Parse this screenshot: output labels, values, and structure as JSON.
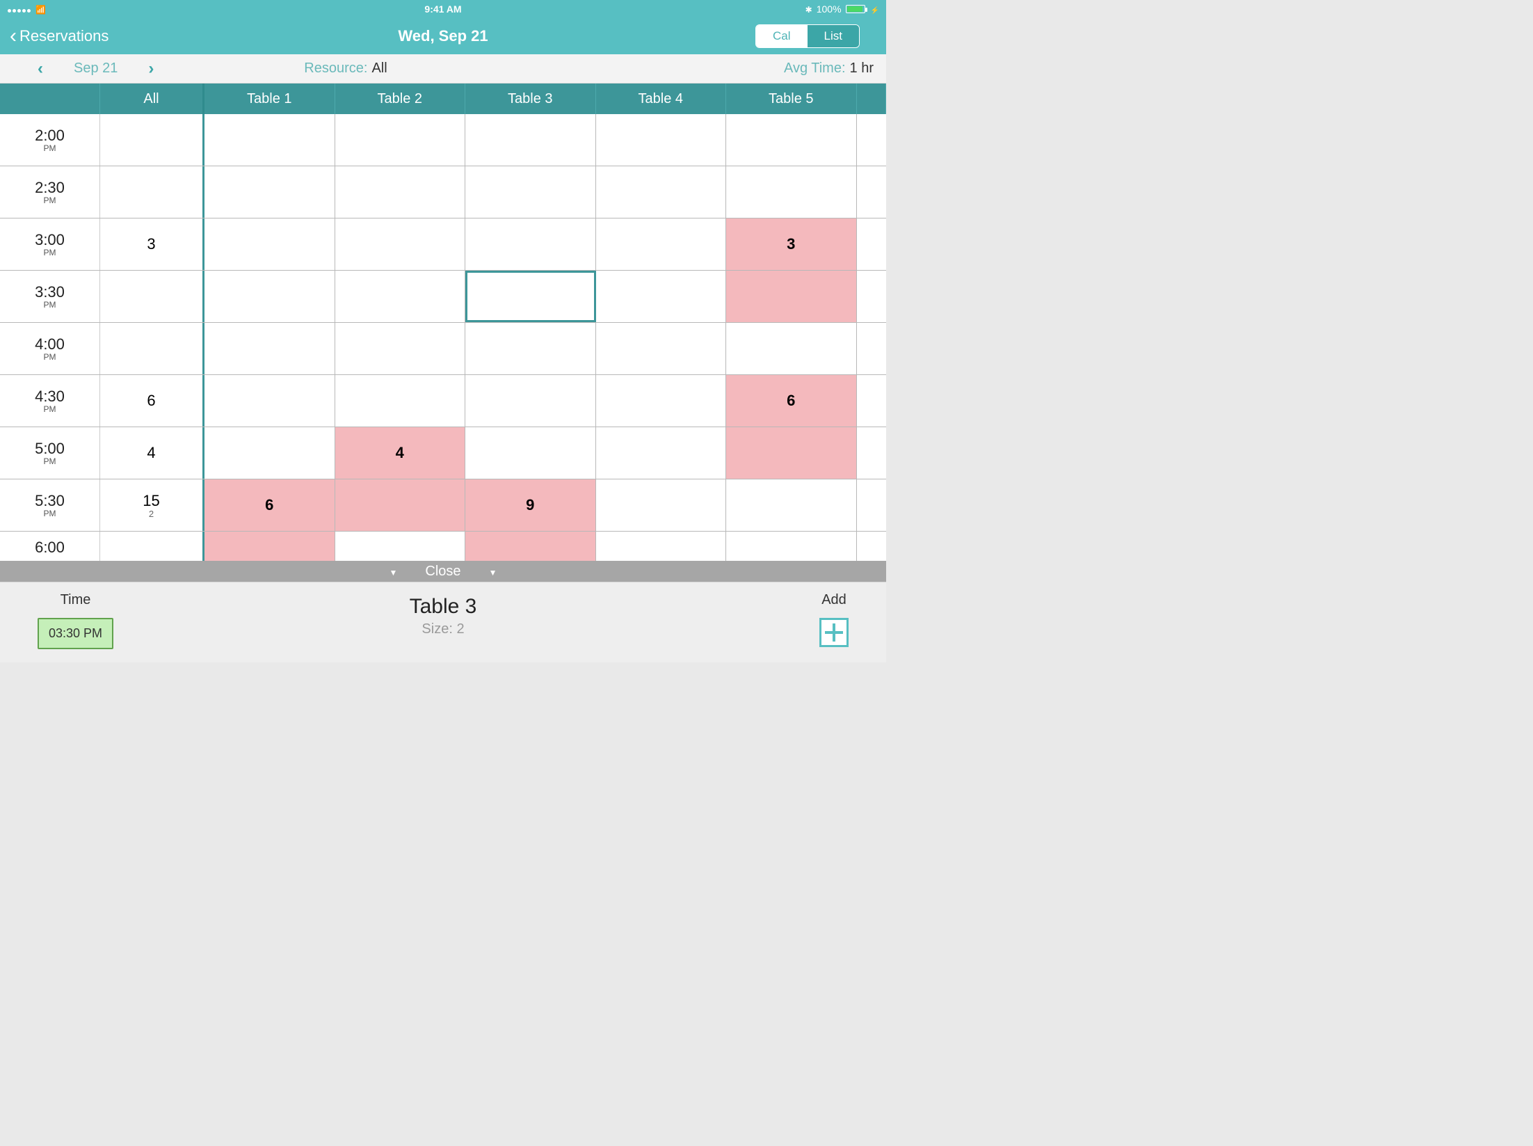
{
  "status_bar": {
    "time": "9:41 AM",
    "battery_pct": "100%"
  },
  "nav": {
    "back_label": "Reservations",
    "title": "Wed, Sep 21",
    "segment_cal": "Cal",
    "segment_list": "List"
  },
  "filter": {
    "date_label": "Sep 21",
    "resource_label": "Resource:",
    "resource_value": "All",
    "avg_label": "Avg Time:",
    "avg_value": "1 hr"
  },
  "columns": {
    "all": "All",
    "resources": [
      "Table 1",
      "Table 2",
      "Table 3",
      "Table 4",
      "Table 5"
    ]
  },
  "rows": [
    {
      "time": "2:00",
      "ampm": "PM",
      "all": "",
      "all_sub": "",
      "cells": [
        {
          "v": "",
          "b": false
        },
        {
          "v": "",
          "b": false
        },
        {
          "v": "",
          "b": false,
          "sel": false
        },
        {
          "v": "",
          "b": false
        },
        {
          "v": "",
          "b": false
        }
      ]
    },
    {
      "time": "2:30",
      "ampm": "PM",
      "all": "",
      "all_sub": "",
      "cells": [
        {
          "v": "",
          "b": false
        },
        {
          "v": "",
          "b": false
        },
        {
          "v": "",
          "b": false
        },
        {
          "v": "",
          "b": false
        },
        {
          "v": "",
          "b": false
        }
      ]
    },
    {
      "time": "3:00",
      "ampm": "PM",
      "all": "3",
      "all_sub": "",
      "cells": [
        {
          "v": "",
          "b": false
        },
        {
          "v": "",
          "b": false
        },
        {
          "v": "",
          "b": false
        },
        {
          "v": "",
          "b": false
        },
        {
          "v": "3",
          "b": true
        }
      ]
    },
    {
      "time": "3:30",
      "ampm": "PM",
      "all": "",
      "all_sub": "",
      "cells": [
        {
          "v": "",
          "b": false
        },
        {
          "v": "",
          "b": false
        },
        {
          "v": "",
          "b": false,
          "sel": true
        },
        {
          "v": "",
          "b": false
        },
        {
          "v": "",
          "b": true
        }
      ]
    },
    {
      "time": "4:00",
      "ampm": "PM",
      "all": "",
      "all_sub": "",
      "cells": [
        {
          "v": "",
          "b": false
        },
        {
          "v": "",
          "b": false
        },
        {
          "v": "",
          "b": false
        },
        {
          "v": "",
          "b": false
        },
        {
          "v": "",
          "b": false
        }
      ]
    },
    {
      "time": "4:30",
      "ampm": "PM",
      "all": "6",
      "all_sub": "",
      "cells": [
        {
          "v": "",
          "b": false
        },
        {
          "v": "",
          "b": false
        },
        {
          "v": "",
          "b": false
        },
        {
          "v": "",
          "b": false
        },
        {
          "v": "6",
          "b": true
        }
      ]
    },
    {
      "time": "5:00",
      "ampm": "PM",
      "all": "4",
      "all_sub": "",
      "cells": [
        {
          "v": "",
          "b": false
        },
        {
          "v": "4",
          "b": true
        },
        {
          "v": "",
          "b": false
        },
        {
          "v": "",
          "b": false
        },
        {
          "v": "",
          "b": true
        }
      ]
    },
    {
      "time": "5:30",
      "ampm": "PM",
      "all": "15",
      "all_sub": "2",
      "cells": [
        {
          "v": "6",
          "b": true
        },
        {
          "v": "",
          "b": true
        },
        {
          "v": "9",
          "b": true
        },
        {
          "v": "",
          "b": false
        },
        {
          "v": "",
          "b": false
        }
      ]
    },
    {
      "time": "6:00",
      "ampm": "",
      "all": "",
      "all_sub": "",
      "cells": [
        {
          "v": "",
          "b": true
        },
        {
          "v": "",
          "b": false
        },
        {
          "v": "",
          "b": true
        },
        {
          "v": "",
          "b": false
        },
        {
          "v": "",
          "b": false
        }
      ],
      "last": true
    }
  ],
  "close_strip": {
    "label": "Close"
  },
  "footer": {
    "time_label": "Time",
    "time_value": "03:30 PM",
    "center_title": "Table 3",
    "size_label": "Size:",
    "size_value": "2",
    "add_label": "Add"
  }
}
